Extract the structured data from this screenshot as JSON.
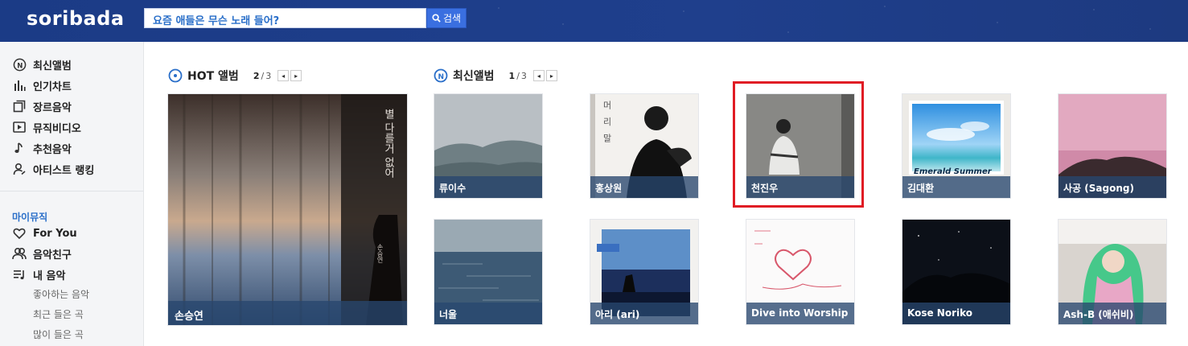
{
  "header": {
    "logo": "soribada",
    "search_placeholder": "요즘 애들은 무슨 노래 들어?",
    "search_button": "검색"
  },
  "sidebar": {
    "items": [
      {
        "label": "최신앨범",
        "icon": "new-album-icon"
      },
      {
        "label": "인기차트",
        "icon": "chart-icon"
      },
      {
        "label": "장르음악",
        "icon": "genre-icon"
      },
      {
        "label": "뮤직비디오",
        "icon": "video-icon"
      },
      {
        "label": "추천음악",
        "icon": "music-note-icon"
      },
      {
        "label": "아티스트 랭킹",
        "icon": "artist-icon"
      }
    ],
    "mymusic_title": "마이뮤직",
    "mymusic_items": [
      {
        "label": "For You",
        "icon": "heart-icon"
      },
      {
        "label": "음악친구",
        "icon": "friends-icon"
      },
      {
        "label": "내 음악",
        "icon": "playlist-icon"
      }
    ],
    "sub_items": [
      "좋아하는 음악",
      "최근 들은 곡",
      "많이 들은 곡"
    ]
  },
  "hot_album": {
    "title": "HOT 앨범",
    "page_current": "2",
    "page_total": "3",
    "album": {
      "artist": "손승연",
      "cover_text": "별 다를거 없어",
      "cover_credit": "손승연"
    }
  },
  "new_album": {
    "title": "최신앨범",
    "page_current": "1",
    "page_total": "3",
    "albums": [
      {
        "artist": "류이수"
      },
      {
        "artist": "홍상원",
        "cover_text": "머 리 말"
      },
      {
        "artist": "천진우"
      },
      {
        "artist": "김대환",
        "cover_text": "Emerald Summer"
      },
      {
        "artist": "사공 (Sagong)"
      },
      {
        "artist": "너울"
      },
      {
        "artist": "아리 (ari)"
      },
      {
        "artist": "Dive into Worship"
      },
      {
        "artist": "Kose Noriko"
      },
      {
        "artist": "Ash-B (애쉬비)"
      }
    ]
  },
  "colors": {
    "header": "#1f3f8c",
    "accent": "#2a6fc9",
    "highlight": "#e01b24"
  }
}
